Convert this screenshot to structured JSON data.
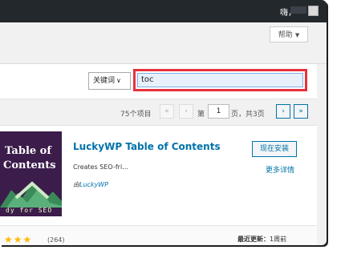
{
  "adminbar": {
    "greeting": "嗨，"
  },
  "help": {
    "label": "帮助",
    "caret": "▼"
  },
  "filter": {
    "select_value": "关键词",
    "select_caret": "∨",
    "search_value": "toc"
  },
  "pagination": {
    "count": "75个项目",
    "first": "«",
    "prev": "‹",
    "page_prefix": "第",
    "current_page": "1",
    "page_suffix": "页，共3页",
    "next": "›",
    "last": "»"
  },
  "plugin": {
    "thumb_line1": "Table of",
    "thumb_line2": "Contents",
    "thumb_line3": "dy for SEO",
    "title": "LuckyWP Table of Contents",
    "description": "Creates SEO-fri...",
    "by_prefix": "由",
    "author": "LuckyWP",
    "install_label": "现在安装",
    "more_label": "更多详情",
    "stars": "★★★",
    "rating_count": "(264)",
    "updated_label": "最近更新：",
    "updated_value": "1周前"
  },
  "colors": {
    "adminbar": "#23282d",
    "accent": "#0073aa",
    "highlight": "#e8303a",
    "star": "#ffb900",
    "thumb_bg": "#3b1c4a"
  }
}
